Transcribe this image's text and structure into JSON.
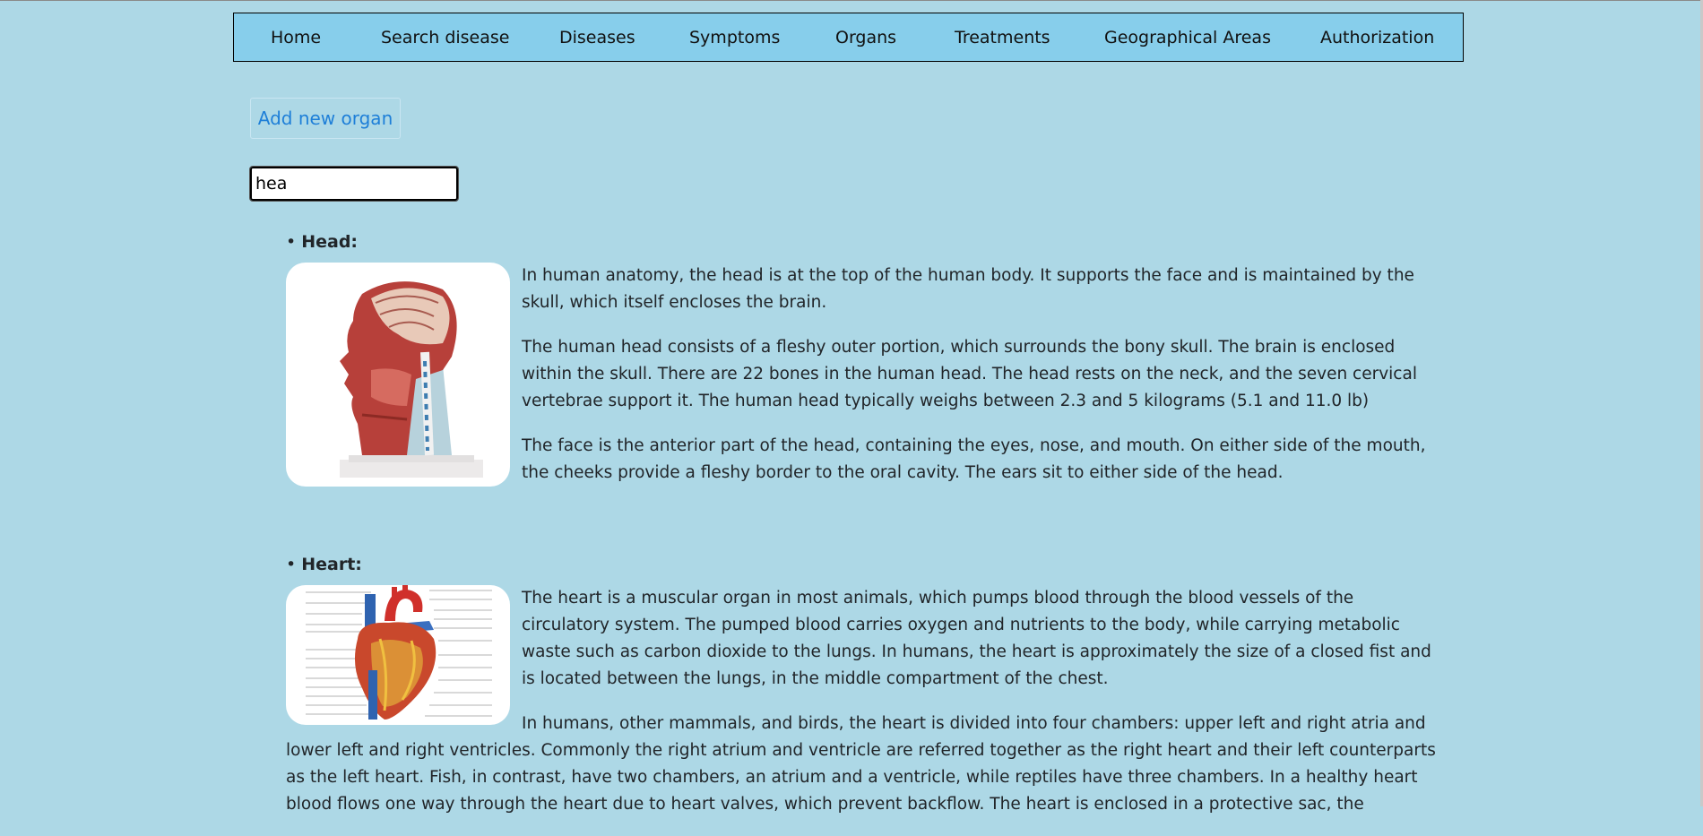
{
  "nav": {
    "items": [
      "Home",
      "Search disease",
      "Diseases",
      "Symptoms",
      "Organs",
      "Treatments",
      "Geographical Areas",
      "Authorization"
    ]
  },
  "actions": {
    "add_label": "Add new organ"
  },
  "search": {
    "value": "hea"
  },
  "organs": [
    {
      "title": "Head:",
      "image_icon": "head-anatomy-model-image",
      "paragraphs": [
        "In human anatomy, the head is at the top of the human body. It supports the face and is maintained by the skull, which itself encloses the brain.",
        "The human head consists of a fleshy outer portion, which surrounds the bony skull. The brain is enclosed within the skull. There are 22 bones in the human head. The head rests on the neck, and the seven cervical vertebrae support it. The human head typically weighs between 2.3 and 5 kilograms (5.1 and 11.0 lb)",
        "The face is the anterior part of the head, containing the eyes, nose, and mouth. On either side of the mouth, the cheeks provide a fleshy border to the oral cavity. The ears sit to either side of the head."
      ]
    },
    {
      "title": "Heart:",
      "image_icon": "heart-anatomy-diagram-image",
      "paragraphs": [
        "The heart is a muscular organ in most animals, which pumps blood through the blood vessels of the circulatory system. The pumped blood carries oxygen and nutrients to the body, while carrying metabolic waste such as carbon dioxide to the lungs. In humans, the heart is approximately the size of a closed fist and is located between the lungs, in the middle compartment of the chest.",
        "In humans, other mammals, and birds, the heart is divided into four chambers: upper left and right atria and lower left and right ventricles. Commonly the right atrium and ventricle are referred together as the right heart and their left counterparts as the left heart. Fish, in contrast, have two chambers, an atrium and a ventricle, while reptiles have three chambers. In a healthy heart blood flows one way through the heart due to heart valves, which prevent backflow. The heart is enclosed in a protective sac, the"
      ]
    }
  ],
  "colors": {
    "background": "#add8e6",
    "navbar": "#87ceeb",
    "link": "#1e7fd8"
  }
}
